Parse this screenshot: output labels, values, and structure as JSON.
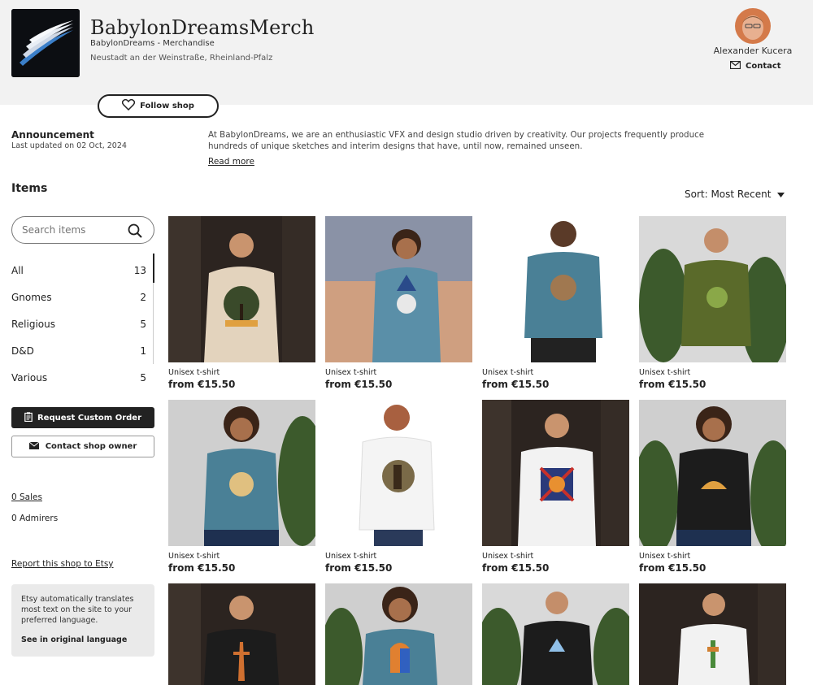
{
  "shop": {
    "name": "BabylonDreamsMerch",
    "subtitle": "BabylonDreams - Merchandise",
    "location": "Neustadt an der Weinstraße, Rheinland-Pfalz",
    "follow_label": "Follow shop"
  },
  "owner": {
    "name": "Alexander Kucera",
    "contact_label": "Contact"
  },
  "announcement": {
    "title": "Announcement",
    "date": "Last updated on 02 Oct, 2024",
    "text": "At BabylonDreams, we are an enthusiastic VFX and design studio driven by creativity. Our projects frequently produce hundreds of unique sketches and interim designs that have, until now, remained unseen.",
    "read_more": "Read more"
  },
  "items_title": "Items",
  "sort_label": "Sort: Most Recent",
  "search": {
    "placeholder": "Search items"
  },
  "categories": [
    {
      "label": "All",
      "count": "13"
    },
    {
      "label": "Gnomes",
      "count": "2"
    },
    {
      "label": "Religious",
      "count": "5"
    },
    {
      "label": "D&D",
      "count": "1"
    },
    {
      "label": "Various",
      "count": "5"
    }
  ],
  "buttons": {
    "request": "Request Custom Order",
    "contact_owner": "Contact shop owner"
  },
  "stats": {
    "sales": "0 Sales",
    "admirers": "0 Admirers"
  },
  "report": "Report this shop to Etsy",
  "translate": {
    "text": "Etsy automatically translates most text on the site to your preferred language.",
    "original": "See in original language"
  },
  "products": [
    {
      "label": "Unisex t-shirt",
      "price": "from €15.50"
    },
    {
      "label": "Unisex t-shirt",
      "price": "from €15.50"
    },
    {
      "label": "Unisex t-shirt",
      "price": "from €15.50"
    },
    {
      "label": "Unisex t-shirt",
      "price": "from €15.50"
    },
    {
      "label": "Unisex t-shirt",
      "price": "from €15.50"
    },
    {
      "label": "Unisex t-shirt",
      "price": "from €15.50"
    },
    {
      "label": "Unisex t-shirt",
      "price": "from €15.50"
    },
    {
      "label": "Unisex t-shirt",
      "price": "from €15.50"
    },
    {
      "label": "",
      "price": ""
    },
    {
      "label": "",
      "price": ""
    },
    {
      "label": "",
      "price": ""
    },
    {
      "label": "",
      "price": ""
    }
  ],
  "colors": {
    "dark": "#222222",
    "band": "#f2f2f2",
    "muted": "#eaeaea"
  }
}
